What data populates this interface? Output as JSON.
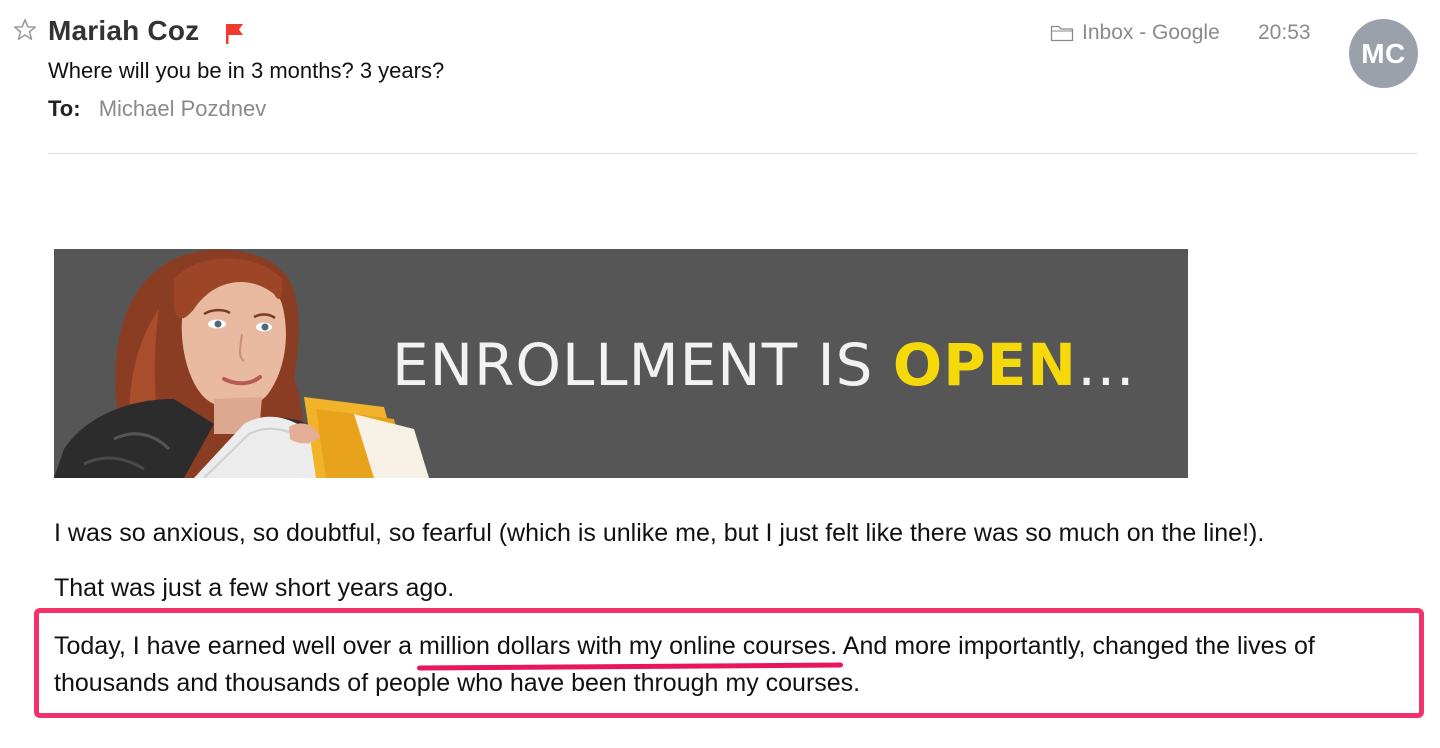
{
  "email": {
    "sender": "Mariah Coz",
    "subject": "Where will you be in 3 months? 3 years?",
    "to_label": "To:",
    "to_name": "Michael Pozdnev",
    "mailbox": "Inbox - Google",
    "time": "20:53",
    "avatar_initials": "MC",
    "flag_color": "#f03a2e",
    "avatar_color": "#9aa1ab",
    "icons": [
      "star-icon",
      "flag-icon",
      "folder-icon"
    ]
  },
  "banner": {
    "text_main": "ENROLLMENT IS ",
    "text_accent": "OPEN",
    "text_trail": "…",
    "background_color": "#565656",
    "accent_color": "#f5d90a"
  },
  "body": {
    "paragraph_1": "I was so anxious, so doubtful, so fearful (which is unlike me, but I just felt like there was so much on the line!).",
    "paragraph_2": "That was just a few short years ago.",
    "paragraph_3_before": "Today, I have earned well over a ",
    "paragraph_3_underlined": "million dollars with my online courses.",
    "paragraph_3_after": " And more importantly, changed the lives of",
    "paragraph_3_line2": "thousands and thousands of people who have been through my courses.",
    "highlight_color": "#f2326b"
  }
}
